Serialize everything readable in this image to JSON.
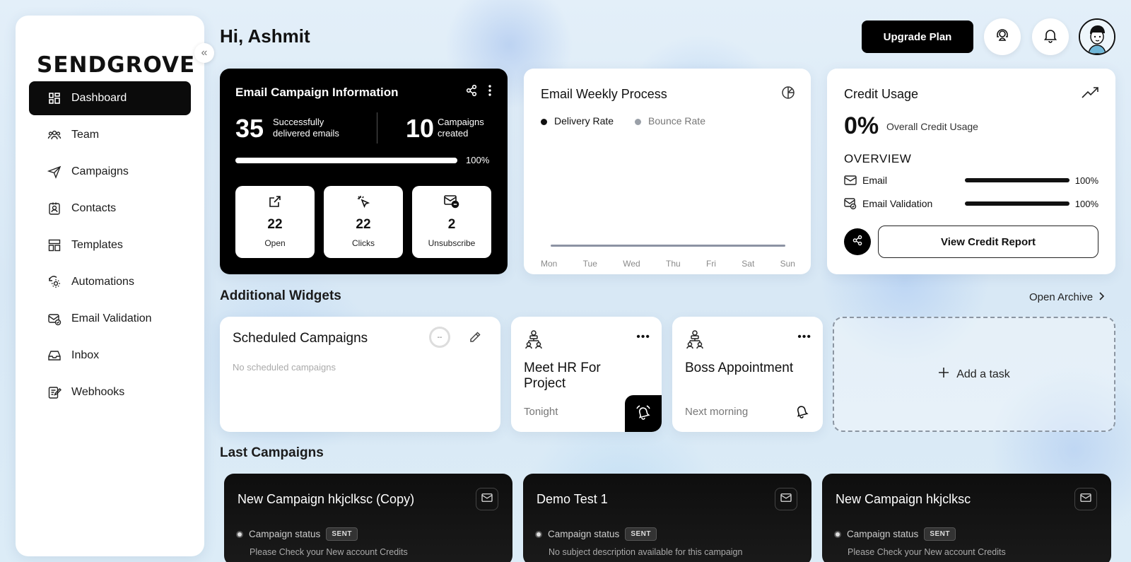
{
  "brand": {
    "logo": "SENDGROVE",
    "collapse_glyph": "«"
  },
  "sidebar": {
    "items": [
      {
        "label": "Dashboard",
        "icon": "dashboard-grid-icon",
        "active": true
      },
      {
        "label": "Team",
        "icon": "team-icon"
      },
      {
        "label": "Campaigns",
        "icon": "paper-plane-icon"
      },
      {
        "label": "Contacts",
        "icon": "contact-card-icon"
      },
      {
        "label": "Templates",
        "icon": "template-layout-icon"
      },
      {
        "label": "Automations",
        "icon": "automation-gear-icon"
      },
      {
        "label": "Email Validation",
        "icon": "email-check-icon"
      },
      {
        "label": "Inbox",
        "icon": "inbox-tray-icon"
      },
      {
        "label": "Webhooks",
        "icon": "webhook-note-icon"
      }
    ]
  },
  "header": {
    "greeting": "Hi, Ashmit",
    "upgrade_label": "Upgrade Plan",
    "icons": [
      "support-headset-icon",
      "bell-icon",
      "avatar"
    ]
  },
  "campaign_info": {
    "title": "Email Campaign Information",
    "delivered_value": "35",
    "delivered_label_1": "Successfully",
    "delivered_label_2": "delivered emails",
    "campaigns_value": "10",
    "campaigns_label_1": "Campaigns",
    "campaigns_label_2": "created",
    "progress_pct": 100,
    "progress_text": "100%",
    "stats": [
      {
        "value": "22",
        "label": "Open",
        "icon": "external-link-icon"
      },
      {
        "value": "22",
        "label": "Clicks",
        "icon": "cursor-click-icon"
      },
      {
        "value": "2",
        "label": "Unsubscribe",
        "icon": "mail-minus-icon"
      }
    ]
  },
  "weekly": {
    "title": "Email Weekly Process",
    "legend": [
      {
        "label": "Delivery Rate",
        "color": "#111111"
      },
      {
        "label": "Bounce Rate",
        "color": "#9aa0a8"
      }
    ],
    "days": [
      "Mon",
      "Tue",
      "Wed",
      "Thu",
      "Fri",
      "Sat",
      "Sun"
    ]
  },
  "credit": {
    "title": "Credit Usage",
    "percent": "0%",
    "percent_label": "Overall Credit Usage",
    "overview_label": "OVERVIEW",
    "rows": [
      {
        "label": "Email",
        "pct": "100%",
        "icon": "mail-icon"
      },
      {
        "label": "Email Validation",
        "pct": "100%",
        "icon": "email-check-icon"
      }
    ],
    "report_label": "View Credit Report"
  },
  "widgets": {
    "section_title": "Additional Widgets",
    "archive_label": "Open Archive",
    "scheduled_title": "Scheduled Campaigns",
    "scheduled_empty": "No scheduled campaigns",
    "spinner_text": "--",
    "tasks": [
      {
        "title": "Meet HR For Project",
        "time": "Tonight"
      },
      {
        "title": "Boss Appointment",
        "time": "Next morning"
      }
    ],
    "add_task_label": "Add a task"
  },
  "last_campaigns": {
    "section_title": "Last Campaigns",
    "status_label": "Campaign status",
    "items": [
      {
        "title": "New Campaign hkjclksc (Copy)",
        "status": "SENT",
        "desc": "Please Check your New account Credits"
      },
      {
        "title": "Demo Test 1",
        "status": "SENT",
        "desc": "No subject description available for this campaign"
      },
      {
        "title": "New Campaign hkjclksc",
        "status": "SENT",
        "desc": "Please Check your New account Credits"
      }
    ]
  }
}
